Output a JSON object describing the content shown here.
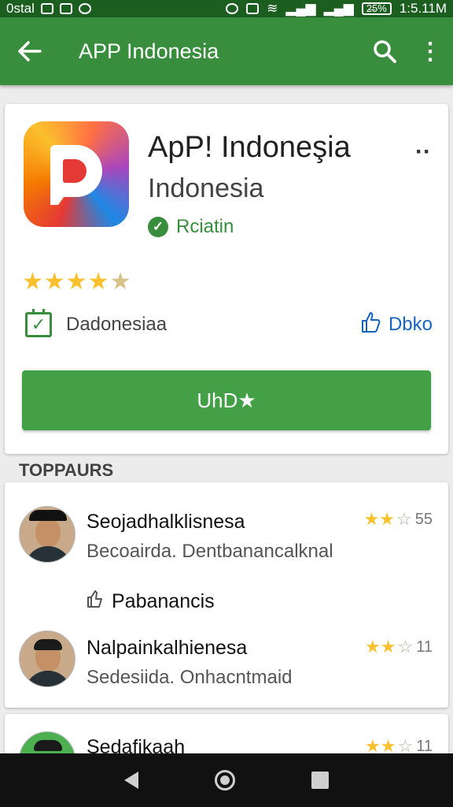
{
  "status_bar": {
    "left_text": "0stal",
    "time": "1:5.11M",
    "battery": "2̶5%"
  },
  "app_bar": {
    "title": "APP Indonesia",
    "back_icon": "arrow-back-icon",
    "search_icon": "search-icon",
    "overflow_icon": "more-vert-icon"
  },
  "app": {
    "name": "ApP! Indoneşia",
    "subtitle": "Indonesia",
    "verified_label": "Rciatin",
    "rating_stars": 4.5,
    "meta_left": "Dadonesiaa",
    "meta_right": "Dbko",
    "install_label": "UhD★",
    "colors": {
      "primary": "#388e3c",
      "accent": "#1565c0",
      "star": "#fbc02d"
    }
  },
  "section_title": "TOPPAURS",
  "reviews": [
    {
      "name": "Seojadhalklisnesa",
      "body": "Becoairda.  Dentbanancalknal",
      "stars": 2.5,
      "count": "55",
      "helpful_label": "Pabanancis"
    },
    {
      "name": "Nalpainkalhienesa",
      "body": "Sedesiida.  Onhacntmaid",
      "stars": 2.5,
      "count": "11"
    },
    {
      "name": "Sedafikaah",
      "stars": 2.5,
      "count": "11"
    }
  ],
  "nav": {
    "back_icon": "nav-back-icon",
    "home_icon": "nav-home-icon",
    "recents_icon": "nav-recents-icon"
  }
}
